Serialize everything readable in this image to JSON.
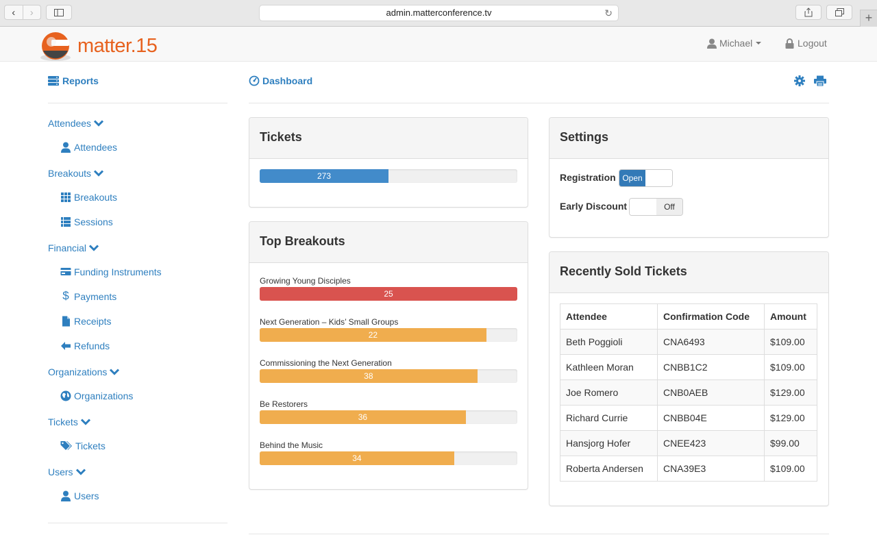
{
  "browser": {
    "url": "admin.matterconference.tv"
  },
  "topnav": {
    "logo_text": "matter",
    "logo_suffix": ".15",
    "user_label": "Michael",
    "logout_label": "Logout"
  },
  "sidebar": {
    "header": "Reports",
    "sections": [
      {
        "label": "Attendees",
        "items": [
          {
            "label": "Attendees",
            "icon": "user-icon"
          }
        ]
      },
      {
        "label": "Breakouts",
        "items": [
          {
            "label": "Breakouts",
            "icon": "grid-icon"
          },
          {
            "label": "Sessions",
            "icon": "list-icon"
          }
        ]
      },
      {
        "label": "Financial",
        "items": [
          {
            "label": "Funding Instruments",
            "icon": "credit-card-icon"
          },
          {
            "label": "Payments",
            "icon": "dollar-icon"
          },
          {
            "label": "Receipts",
            "icon": "file-icon"
          },
          {
            "label": "Refunds",
            "icon": "arrow-left-icon"
          }
        ]
      },
      {
        "label": "Organizations",
        "items": [
          {
            "label": "Organizations",
            "icon": "globe-icon"
          }
        ]
      },
      {
        "label": "Tickets",
        "items": [
          {
            "label": "Tickets",
            "icon": "tags-icon"
          }
        ]
      },
      {
        "label": "Users",
        "items": [
          {
            "label": "Users",
            "icon": "user-icon"
          }
        ]
      }
    ]
  },
  "main": {
    "header": "Dashboard",
    "tickets": {
      "title": "Tickets",
      "count": "273",
      "fill": 0.5
    },
    "top_breakouts": {
      "title": "Top Breakouts",
      "items": [
        {
          "name": "Growing Young Disciples",
          "value": "25",
          "fill": 1.0,
          "color": "#d9534f"
        },
        {
          "name": "Next Generation – Kids’ Small Groups",
          "value": "22",
          "fill": 0.88,
          "color": "#f0ad4e"
        },
        {
          "name": "Commissioning the Next Generation",
          "value": "38",
          "fill": 0.845,
          "color": "#f0ad4e"
        },
        {
          "name": "Be Restorers",
          "value": "36",
          "fill": 0.8,
          "color": "#f0ad4e"
        },
        {
          "name": "Behind the Music",
          "value": "34",
          "fill": 0.755,
          "color": "#f0ad4e"
        }
      ]
    },
    "settings": {
      "title": "Settings",
      "registration_label": "Registration",
      "registration_state": "Open",
      "discount_label": "Early Discount",
      "discount_state": "Off"
    },
    "recent": {
      "title": "Recently Sold Tickets",
      "headers": [
        "Attendee",
        "Confirmation Code",
        "Amount"
      ],
      "rows": [
        [
          "Beth Poggioli",
          "CNA6493",
          "$109.00"
        ],
        [
          "Kathleen Moran",
          "CNBB1C2",
          "$109.00"
        ],
        [
          "Joe Romero",
          "CNB0AEB",
          "$129.00"
        ],
        [
          "Richard Currie",
          "CNBB04E",
          "$129.00"
        ],
        [
          "Hansjorg Hofer",
          "CNEE423",
          "$99.00"
        ],
        [
          "Roberta Andersen",
          "CNA39E3",
          "$109.00"
        ]
      ]
    }
  },
  "colors": {
    "link": "#2e7fbf",
    "primary": "#337ab7",
    "danger": "#d9534f",
    "warning": "#f0ad4e",
    "brand": "#e7621f"
  }
}
